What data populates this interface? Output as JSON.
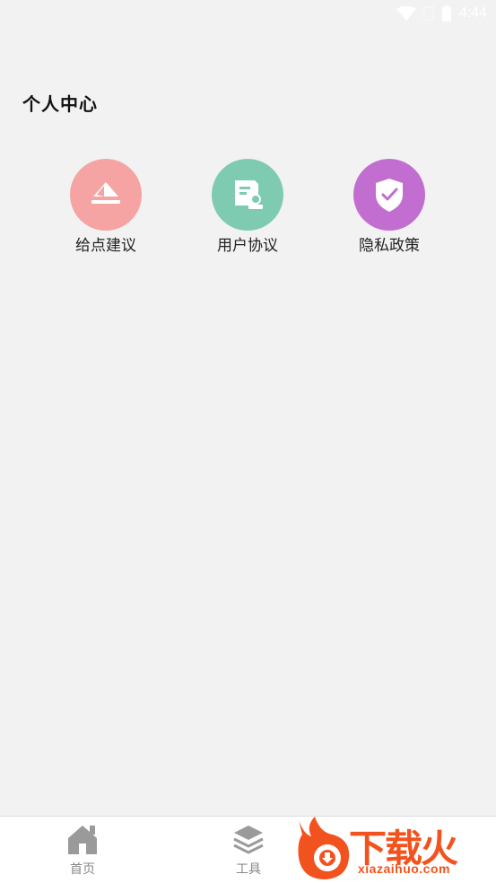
{
  "status": {
    "time": "4:44"
  },
  "page": {
    "title": "个人中心"
  },
  "menu": [
    {
      "label": "给点建议",
      "icon": "feedback-icon",
      "color": "#f5a3a3"
    },
    {
      "label": "用户协议",
      "icon": "agreement-icon",
      "color": "#7ecbb1"
    },
    {
      "label": "隐私政策",
      "icon": "shield-check-icon",
      "color": "#c16ed0"
    }
  ],
  "tabs": [
    {
      "label": "首页",
      "icon": "home-icon"
    },
    {
      "label": "工具",
      "icon": "layers-icon"
    }
  ],
  "watermark": {
    "text": "下载火",
    "sub": "xiazaihuo.com"
  }
}
